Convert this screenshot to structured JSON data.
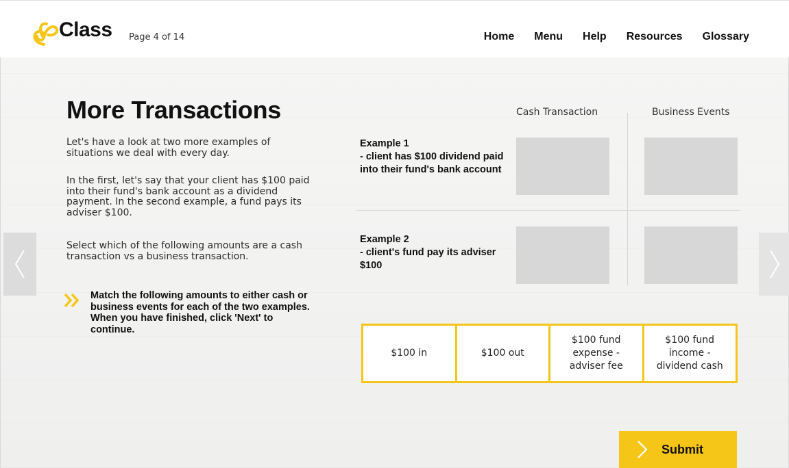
{
  "header": {
    "brand": "Class",
    "page_counter": "Page 4 of 14",
    "nav": [
      "Home",
      "Menu",
      "Help",
      "Resources",
      "Glossary"
    ]
  },
  "content": {
    "title": "More Transactions",
    "paragraphs": [
      "Let's have a look at two more examples of situations we deal with every day.",
      "In the first, let's say that your client has $100 paid into their fund's bank account as a dividend payment. In the second example, a fund pays its adviser $100.",
      "Select which of the following amounts are a cash transaction vs a business transaction."
    ],
    "instruction": "Match the following amounts to either cash or business events for each of the two examples. When you have finished, click 'Next' to continue."
  },
  "grid": {
    "columns": [
      "Cash Transaction",
      "Business Events"
    ],
    "examples": [
      {
        "title": "Example 1",
        "description": "- client has $100 dividend paid into their fund's bank account"
      },
      {
        "title": "Example 2",
        "description": "- client's fund pay its adviser $100"
      }
    ]
  },
  "options": [
    "$100 in",
    "$100 out",
    "$100 fund expense - adviser fee",
    "$100 fund income - dividend cash"
  ],
  "submit_label": "Submit",
  "icons": {
    "logo": "class-logo-icon",
    "prev": "chevron-left-icon",
    "next": "chevron-right-icon",
    "instruction": "double-chevron-icon",
    "submit": "chevron-right-icon"
  },
  "colors": {
    "accent": "#f5c518",
    "drop_zone": "#d7d7d7",
    "side_arrow": "#dcdcdc"
  }
}
